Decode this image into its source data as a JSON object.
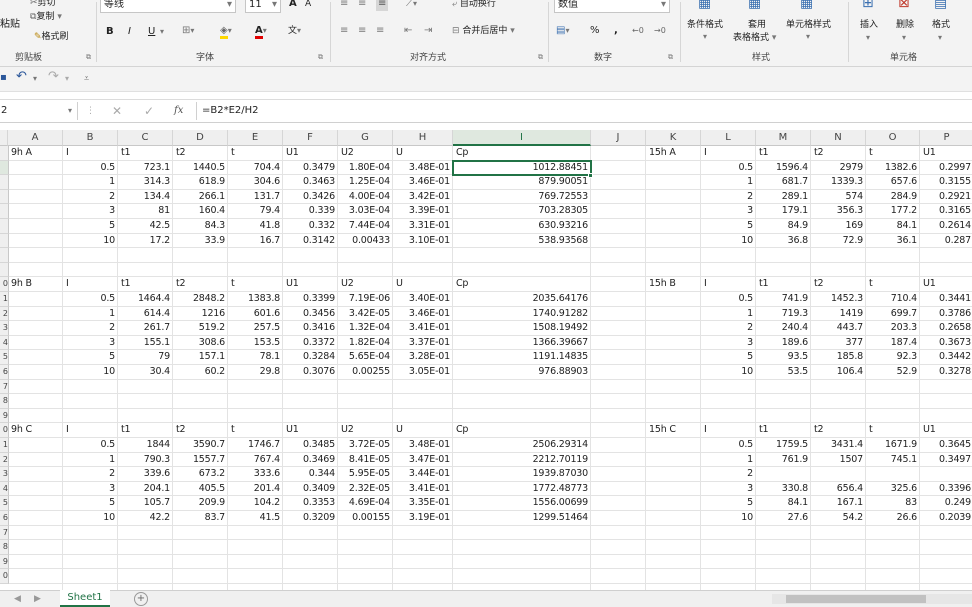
{
  "ribbon": {
    "clipboard": {
      "paste": "粘贴",
      "cut": "剪切",
      "copy": "复制",
      "format_painter": "格式刷",
      "group": "剪贴板"
    },
    "font": {
      "font_name": "等线",
      "font_size": "11",
      "grow": "A",
      "shrink": "A",
      "bold": "B",
      "italic": "I",
      "underline": "U",
      "phonetic": "文",
      "group": "字体"
    },
    "alignment": {
      "wrap_text": "自动换行",
      "merge_center": "合并后居中",
      "group": "对齐方式"
    },
    "number": {
      "format": "数值",
      "percent": "%",
      "comma": ",",
      "group": "数字"
    },
    "styles": {
      "conditional": "条件格式",
      "table_format_1": "套用",
      "table_format_2": "表格格式",
      "cell_styles": "单元格样式",
      "group": "样式"
    },
    "cells": {
      "insert": "插入",
      "delete": "删除",
      "format": "格式",
      "group": "单元格"
    }
  },
  "formula_bar": {
    "name_box": "2",
    "fx": "fx",
    "formula": "=B2*E2/H2"
  },
  "columns": [
    "A",
    "B",
    "C",
    "D",
    "E",
    "F",
    "G",
    "H",
    "I",
    "J",
    "K",
    "L",
    "M",
    "N",
    "O",
    "P"
  ],
  "row_numbers": [
    "",
    "",
    "",
    "",
    "",
    "",
    "",
    "",
    "",
    "0",
    "1",
    "2",
    "3",
    "4",
    "5",
    "6",
    "7",
    "8",
    "9",
    "0",
    "1",
    "2",
    "3",
    "4",
    "5",
    "6",
    "7",
    "8",
    "9",
    "0"
  ],
  "sections": [
    {
      "title": "9h A",
      "header": [
        "I",
        "t1",
        "t2",
        "t",
        "U1",
        "U2",
        "U",
        "Cp"
      ],
      "rows": [
        [
          "0.5",
          "723.1",
          "1440.5",
          "704.4",
          "0.3479",
          "1.80E-04",
          "3.48E-01",
          "1012.88451"
        ],
        [
          "1",
          "314.3",
          "618.9",
          "304.6",
          "0.3463",
          "1.25E-04",
          "3.46E-01",
          "879.90051"
        ],
        [
          "2",
          "134.4",
          "266.1",
          "131.7",
          "0.3426",
          "4.00E-04",
          "3.42E-01",
          "769.72553"
        ],
        [
          "3",
          "81",
          "160.4",
          "79.4",
          "0.339",
          "3.03E-04",
          "3.39E-01",
          "703.28305"
        ],
        [
          "5",
          "42.5",
          "84.3",
          "41.8",
          "0.332",
          "7.44E-04",
          "3.31E-01",
          "630.93216"
        ],
        [
          "10",
          "17.2",
          "33.9",
          "16.7",
          "0.3142",
          "0.00433",
          "3.10E-01",
          "538.93568"
        ]
      ]
    },
    {
      "title": "9h B",
      "header": [
        "I",
        "t1",
        "t2",
        "t",
        "U1",
        "U2",
        "U",
        "Cp"
      ],
      "rows": [
        [
          "0.5",
          "1464.4",
          "2848.2",
          "1383.8",
          "0.3399",
          "7.19E-06",
          "3.40E-01",
          "2035.64176"
        ],
        [
          "1",
          "614.4",
          "1216",
          "601.6",
          "0.3456",
          "3.42E-05",
          "3.46E-01",
          "1740.91282"
        ],
        [
          "2",
          "261.7",
          "519.2",
          "257.5",
          "0.3416",
          "1.32E-04",
          "3.41E-01",
          "1508.19492"
        ],
        [
          "3",
          "155.1",
          "308.6",
          "153.5",
          "0.3372",
          "1.82E-04",
          "3.37E-01",
          "1366.39667"
        ],
        [
          "5",
          "79",
          "157.1",
          "78.1",
          "0.3284",
          "5.65E-04",
          "3.28E-01",
          "1191.14835"
        ],
        [
          "10",
          "30.4",
          "60.2",
          "29.8",
          "0.3076",
          "0.00255",
          "3.05E-01",
          "976.88903"
        ]
      ]
    },
    {
      "title": "9h C",
      "header": [
        "I",
        "t1",
        "t2",
        "t",
        "U1",
        "U2",
        "U",
        "Cp"
      ],
      "rows": [
        [
          "0.5",
          "1844",
          "3590.7",
          "1746.7",
          "0.3485",
          "3.72E-05",
          "3.48E-01",
          "2506.29314"
        ],
        [
          "1",
          "790.3",
          "1557.7",
          "767.4",
          "0.3469",
          "8.41E-05",
          "3.47E-01",
          "2212.70119"
        ],
        [
          "2",
          "339.6",
          "673.2",
          "333.6",
          "0.344",
          "5.95E-05",
          "3.44E-01",
          "1939.87030"
        ],
        [
          "3",
          "204.1",
          "405.5",
          "201.4",
          "0.3409",
          "2.32E-05",
          "3.41E-01",
          "1772.48773"
        ],
        [
          "5",
          "105.7",
          "209.9",
          "104.2",
          "0.3353",
          "4.69E-04",
          "3.35E-01",
          "1556.00699"
        ],
        [
          "10",
          "42.2",
          "83.7",
          "41.5",
          "0.3209",
          "0.00155",
          "3.19E-01",
          "1299.51464"
        ]
      ]
    }
  ],
  "right_sections": [
    {
      "title": "15h A",
      "header": [
        "I",
        "t1",
        "t2",
        "t",
        "U1"
      ],
      "rows": [
        [
          "0.5",
          "1596.4",
          "2979",
          "1382.6",
          "0.2997"
        ],
        [
          "1",
          "681.7",
          "1339.3",
          "657.6",
          "0.3155"
        ],
        [
          "2",
          "289.1",
          "574",
          "284.9",
          "0.2921"
        ],
        [
          "3",
          "179.1",
          "356.3",
          "177.2",
          "0.3165"
        ],
        [
          "5",
          "84.9",
          "169",
          "84.1",
          "0.2614"
        ],
        [
          "10",
          "36.8",
          "72.9",
          "36.1",
          "0.287"
        ]
      ]
    },
    {
      "title": "15h B",
      "header": [
        "I",
        "t1",
        "t2",
        "t",
        "U1"
      ],
      "rows": [
        [
          "0.5",
          "741.9",
          "1452.3",
          "710.4",
          "0.3441"
        ],
        [
          "1",
          "719.3",
          "1419",
          "699.7",
          "0.3786"
        ],
        [
          "2",
          "240.4",
          "443.7",
          "203.3",
          "0.2658"
        ],
        [
          "3",
          "189.6",
          "377",
          "187.4",
          "0.3673"
        ],
        [
          "5",
          "93.5",
          "185.8",
          "92.3",
          "0.3442"
        ],
        [
          "10",
          "53.5",
          "106.4",
          "52.9",
          "0.3278"
        ]
      ]
    },
    {
      "title": "15h C",
      "header": [
        "I",
        "t1",
        "t2",
        "t",
        "U1"
      ],
      "rows": [
        [
          "0.5",
          "1759.5",
          "3431.4",
          "1671.9",
          "0.3645"
        ],
        [
          "1",
          "761.9",
          "1507",
          "745.1",
          "0.3497"
        ],
        [
          "2",
          "",
          "",
          "",
          ""
        ],
        [
          "3",
          "330.8",
          "656.4",
          "325.6",
          "0.3396"
        ],
        [
          "5",
          "84.1",
          "167.1",
          "83",
          "0.249"
        ],
        [
          "10",
          "27.6",
          "54.2",
          "26.6",
          "0.2039"
        ]
      ]
    }
  ],
  "sheet_tab": "Sheet1",
  "add_sheet": "+",
  "colors": {
    "accent": "#217346",
    "grid_line": "#e3e3e3",
    "ribbon_bg": "#f3f3f3"
  }
}
